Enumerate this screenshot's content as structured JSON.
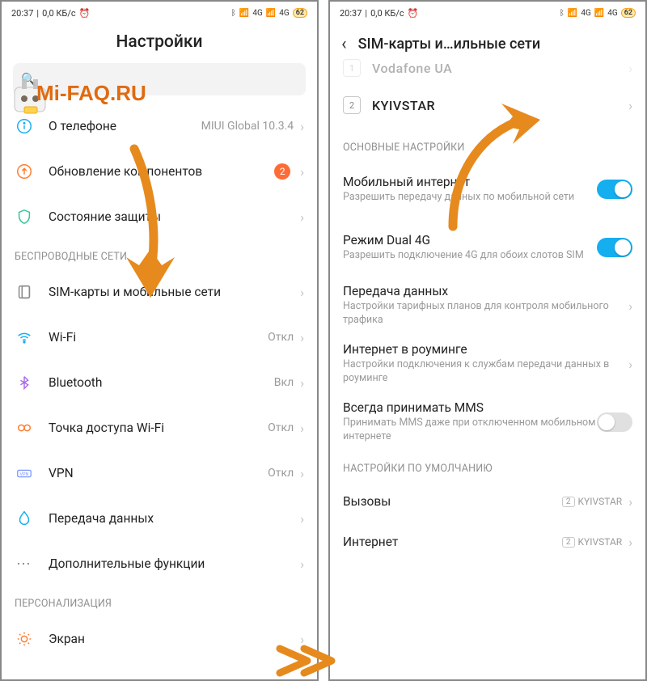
{
  "status": {
    "time": "20:37",
    "speed": "0,0 КБ/с",
    "net": "4G",
    "battery": "62"
  },
  "watermark": "Mi-FAQ.RU",
  "left": {
    "title": "Настройки",
    "search_placeholder": "",
    "rows": {
      "about": {
        "label": "О телефоне",
        "value": "MIUI Global 10.3.4"
      },
      "update": {
        "label": "Обновление компонентов",
        "badge": "2"
      },
      "security": {
        "label": "Состояние защиты"
      }
    },
    "section_wireless": "БЕСПРОВОДНЫЕ СЕТИ",
    "wireless": {
      "sim": {
        "label": "SIM-карты и мобильные сети"
      },
      "wifi": {
        "label": "Wi-Fi",
        "value": "Откл"
      },
      "bt": {
        "label": "Bluetooth",
        "value": "Вкл"
      },
      "hotspot": {
        "label": "Точка доступа Wi-Fi",
        "value": "Откл"
      },
      "vpn": {
        "label": "VPN",
        "value": "Откл"
      },
      "data": {
        "label": "Передача данных"
      },
      "more": {
        "label": "Дополнительные функции"
      }
    },
    "section_personal": "ПЕРСОНАЛИЗАЦИЯ",
    "personal": {
      "screen": {
        "label": "Экран"
      }
    }
  },
  "right": {
    "title": "SIM-карты и…ильные сети",
    "sim1": {
      "num": "1",
      "name": "Vodafone UA"
    },
    "sim2": {
      "num": "2",
      "name": "KYIVSTAR"
    },
    "section_main": "ОСНОВНЫЕ НАСТРОЙКИ",
    "mobile_net": {
      "title": "Мобильный интернет",
      "sub": "Разрешить передачу данных по мобильной сети"
    },
    "dual4g": {
      "title": "Режим Dual 4G",
      "sub": "Разрешить подключение 4G для обоих слотов SIM"
    },
    "data_transfer": {
      "title": "Передача данных",
      "sub": "Настройки тарифных планов для контроля мобильного трафика"
    },
    "roaming": {
      "title": "Интернет в роуминге",
      "sub": "Настройки подключения к службам передачи данных в роуминге"
    },
    "mms": {
      "title": "Всегда принимать MMS",
      "sub": "Принимать MMS даже при отключенном мобильном интернете"
    },
    "section_default": "НАСТРОЙКИ ПО УМОЛЧАНИЮ",
    "calls": {
      "title": "Вызовы",
      "value": "KYIVSTAR",
      "sim": "2"
    },
    "internet": {
      "title": "Интернет",
      "value": "KYIVSTAR",
      "sim": "2"
    }
  }
}
